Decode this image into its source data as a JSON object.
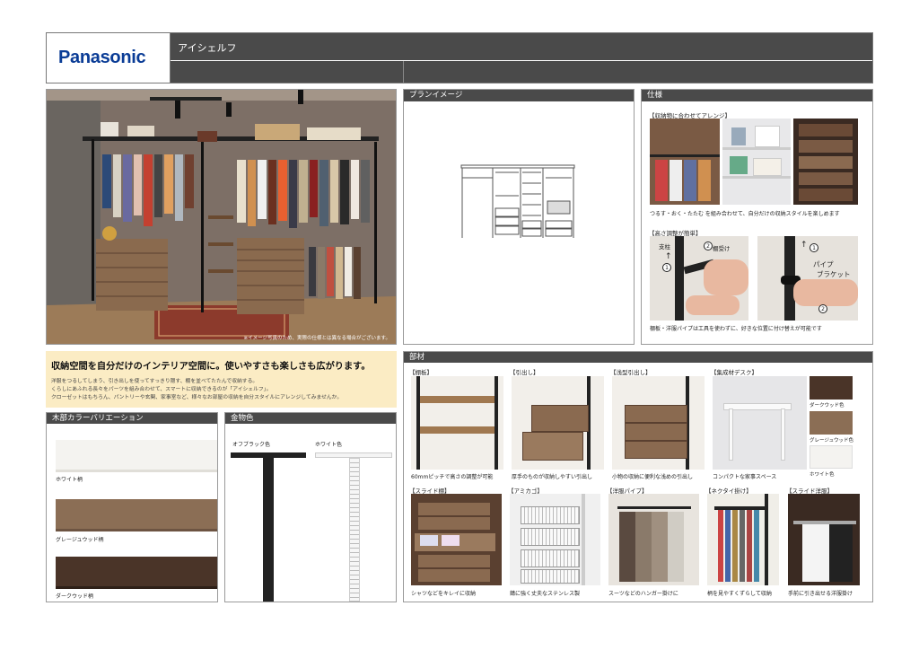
{
  "header": {
    "brand": "Panasonic",
    "product": "アイシェルフ"
  },
  "main_photo": {
    "note": "※イメージ写真のため、実際の仕様とは異なる場合がございます。"
  },
  "plan": {
    "title": "プランイメージ"
  },
  "spec": {
    "title": "仕様",
    "arrange_heading": "【収納物に合わせてアレンジ】",
    "arrange_text": "つるす・おく・たたむ を組み合わせて、自分だけの収納スタイルを楽しめます",
    "height_heading": "【高さ調整が簡単】",
    "label_pillar": "支柱",
    "label_bracket_holder": "棚受け",
    "label_pipe_bracket_1": "パイプ",
    "label_pipe_bracket_2": "ブラケット",
    "n1": "1",
    "n2": "2",
    "height_text": "棚板・洋服パイプは工具を使わずに、好きな位置に付け替えが可能です"
  },
  "tagline": {
    "title": "収納空間を自分だけのインテリア空間に。使いやすさも楽しさも広がります。",
    "line1": "洋服をつるしてしまう、引き出しを使ってすっきり隠す、棚を並べてたたんで収納する。",
    "line2": "くらしにあふれる長々をパーツを組み合わせて、スマートに収納できるのが「アイシェルフ」。",
    "line3": "クローゼットはもちろん、パントリーや玄関、家事室など、様々なお部屋の収納を自分スタイルにアレンジしてみませんか。"
  },
  "wood": {
    "title": "木部カラーバリエーション",
    "items": [
      {
        "name": "ホワイト柄",
        "color": "#f4f3f0"
      },
      {
        "name": "グレージュウッド柄",
        "color": "#8b6e55"
      },
      {
        "name": "ダークウッド柄",
        "color": "#4a3428"
      }
    ]
  },
  "metal": {
    "title": "金物色",
    "items": [
      {
        "name": "オフブラック色",
        "color": "#222222"
      },
      {
        "name": "ホワイト色",
        "color": "#f2f2f2"
      }
    ]
  },
  "parts": {
    "title": "部材",
    "items": [
      {
        "heading": "【棚板】",
        "caption": "60mmピッチで高さの調整が可能"
      },
      {
        "heading": "【引出し】",
        "caption": "厚手のものが収納しやすい引出し"
      },
      {
        "heading": "【浅型引出し】",
        "caption": "小物の収納に便利な浅めの引出し"
      },
      {
        "heading": "【集成材デスク】",
        "caption": "コンパクトな家事スペース"
      },
      {
        "heading": "【スライド棚】",
        "caption": "シャツなどをキレイに収納"
      },
      {
        "heading": "【アミカゴ】",
        "caption": "錆に強く丈夫なステンレス製"
      },
      {
        "heading": "【洋服パイプ】",
        "caption": "スーツなどのハンガー掛けに"
      },
      {
        "heading": "【ネクタイ掛け】",
        "caption": "柄を見やすくずらして収納"
      },
      {
        "heading": "【スライド洋服】",
        "caption": "手前に引き出せる洋服掛け"
      }
    ],
    "desk_colors": [
      {
        "name": "ダークウッド色",
        "color": "#4a3428"
      },
      {
        "name": "グレージュウッド色",
        "color": "#8b6e55"
      },
      {
        "name": "ホワイト色",
        "color": "#f4f3f0"
      }
    ]
  },
  "colors": {
    "brand_blue": "#0a3c96",
    "header_gray": "#4a4a4a",
    "tagline_bg": "#fbecc4"
  }
}
